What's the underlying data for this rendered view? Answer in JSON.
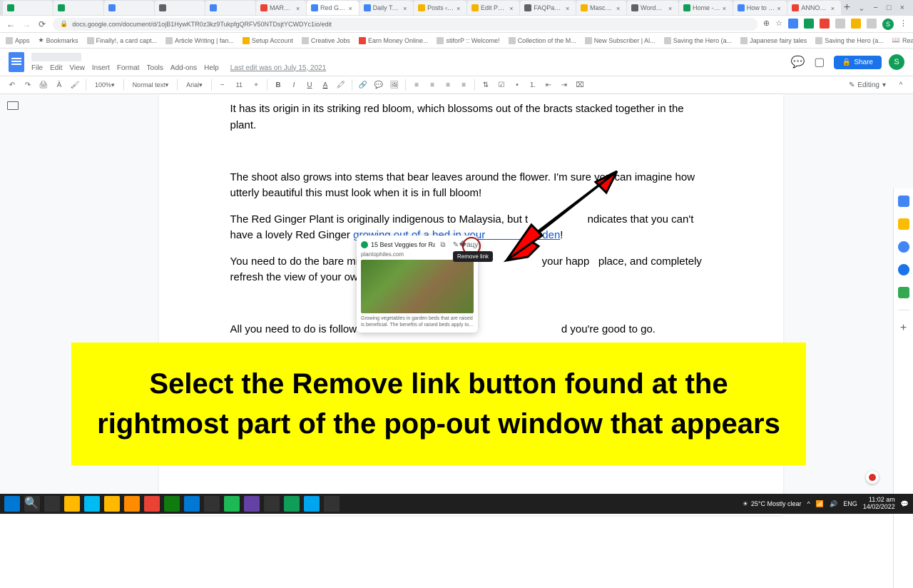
{
  "browser": {
    "tabs": [
      "",
      "",
      "",
      "",
      "",
      "MARCEL -",
      "Red Ginger",
      "Daily Task S",
      "Posts ‹ Mas",
      "Edit Post \"2",
      "FAQPage JS",
      "Maschituts",
      "WordCount",
      "Home - Can",
      "How to Rem",
      "ANNOYING"
    ],
    "active_tab_index": 6,
    "url": "docs.google.com/document/d/1ojB1HywKTR0z3kz9TukpfgQRFV50NTDsjtYCWDYc1io/edit",
    "window_controls": {
      "min": "−",
      "max": "□",
      "close": "×",
      "down": "⌄"
    },
    "bookmarks": [
      "Apps",
      "Bookmarks",
      "Finally!, a card capt...",
      "Article Writing | fan...",
      "Setup Account",
      "Creative Jobs",
      "Earn Money Online...",
      "stiforP :: Welcome!",
      "Collection of the M...",
      "New Subscriber | Al...",
      "Saving the Hero (a...",
      "Japanese fairy tales",
      "Saving the Hero (a..."
    ],
    "reading_list": "Reading list"
  },
  "docs": {
    "menu": {
      "file": "File",
      "edit": "Edit",
      "view": "View",
      "insert": "Insert",
      "format": "Format",
      "tools": "Tools",
      "addons": "Add-ons",
      "help": "Help"
    },
    "last_edit": "Last edit was on July 15, 2021",
    "share": "Share",
    "avatar": "S",
    "toolbar": {
      "zoom": "100%",
      "style": "Normal text",
      "font": "Arial",
      "size": "11",
      "editing": "Editing"
    }
  },
  "content": {
    "p1": "It has its origin in its striking red bloom, which blossoms out of the bracts stacked together in the plant.",
    "p2": "The shoot also grows into stems that bear leaves around the flower. I'm sure you can imagine how utterly beautiful this must look when it is in full bloom!",
    "p3a": "The Red Ginger Plant is originally indigenous to Malaysia, but t",
    "p3b": "ndicates that you can't have a lovely Red Ginger ",
    "link_text_a": "growing out of a bed in your",
    "link_text_b": "arden",
    "p3c": "!",
    "p4": "You need to do the bare minim                                                        your happ   place, and completely refresh the view of your own ga",
    "p5": "All you need to do is follow son                                                              d you're good to go."
  },
  "popup": {
    "title": "15 Best Veggies for Raised...",
    "url": "plantophiles.com",
    "description": "Growing vegetables in garden beds that are raised is beneficial. The benefits of raised beds apply to...",
    "tooltip": "Remove link"
  },
  "annotation": {
    "banner": "Select the Remove link button found at the rightmost part of the pop-out window that appears"
  },
  "taskbar": {
    "weather": "25°C Mostly clear",
    "lang": "ENG",
    "time": "11:02 am",
    "date": "14/02/2022"
  }
}
